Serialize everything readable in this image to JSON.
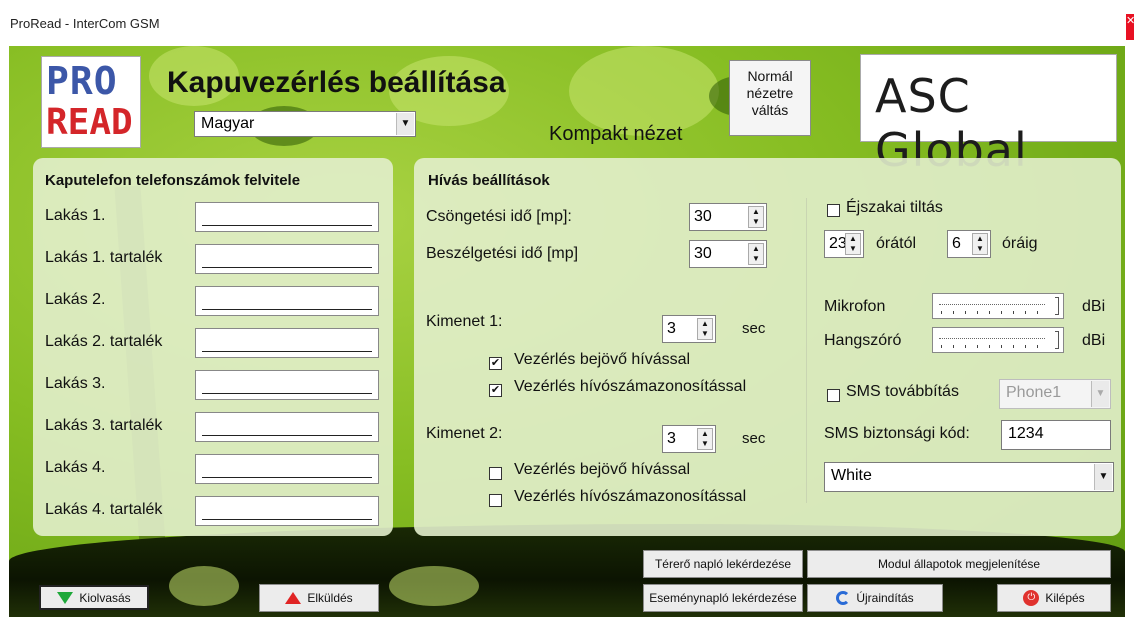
{
  "window": {
    "title": "ProRead - InterCom GSM",
    "close_glyph": "✕"
  },
  "logo": {
    "line1": "PRO",
    "line2": "READ",
    "brand_text": "ASC Global"
  },
  "header": {
    "title": "Kapuvezérlés beállítása",
    "language": "Magyar",
    "compact_label": "Kompakt nézet",
    "normal_view_button_line1": "Normál",
    "normal_view_button_line2": "nézetre",
    "normal_view_button_line3": "váltás"
  },
  "phones": {
    "title": "Kaputelefon telefonszámok felvitele",
    "rows": [
      {
        "label": "Lakás 1."
      },
      {
        "label": "Lakás 1. tartalék"
      },
      {
        "label": "Lakás 2."
      },
      {
        "label": "Lakás 2. tartalék"
      },
      {
        "label": "Lakás 3."
      },
      {
        "label": "Lakás 3. tartalék"
      },
      {
        "label": "Lakás 4."
      },
      {
        "label": "Lakás 4. tartalék"
      }
    ]
  },
  "call": {
    "title": "Hívás beállítások",
    "ring_time_label": "Csöngetési idő [mp]:",
    "ring_time_value": "30",
    "talk_time_label": "Beszélgetési idő [mp]",
    "talk_time_value": "30",
    "output1_label": "Kimenet 1:",
    "output1_value": "3",
    "output1_unit": "sec",
    "output1_incoming_label": "Vezérlés bejövő hívással",
    "output1_incoming_checked": true,
    "output1_callerid_label": "Vezérlés hívószámazonosítással",
    "output1_callerid_checked": true,
    "output2_label": "Kimenet 2:",
    "output2_value": "3",
    "output2_unit": "sec",
    "output2_incoming_label": "Vezérlés bejövő hívással",
    "output2_incoming_checked": false,
    "output2_callerid_label": "Vezérlés hívószámazonosítással",
    "output2_callerid_checked": false
  },
  "night": {
    "label": "Éjszakai tiltás",
    "checked": false,
    "from_value": "23",
    "from_label": "órától",
    "to_value": "6",
    "to_label": "óráig"
  },
  "audio": {
    "mic_label": "Mikrofon",
    "mic_unit": "dBi",
    "speaker_label": "Hangszóró",
    "speaker_unit": "dBi"
  },
  "sms": {
    "forward_label": "SMS továbbítás",
    "forward_checked": false,
    "phone_select": "Phone1",
    "code_label": "SMS biztonsági kód:",
    "code_value": "1234",
    "theme_select": "White"
  },
  "buttons": {
    "signal_log": "Térerő napló lekérdezése",
    "module_status": "Modul állapotok megjelenítése",
    "read": "Kiolvasás",
    "send": "Elküldés",
    "event_log": "Eseménynapló lekérdezése",
    "restart": "Újraindítás",
    "exit": "Kilépés"
  },
  "colors": {
    "background_green": "#86bd22",
    "panel": "#e2eecc",
    "exit_icon": "#e0322e",
    "send_icon": "#e02424",
    "read_icon": "#1ea83a",
    "restart_icon": "#2a6bd6"
  }
}
